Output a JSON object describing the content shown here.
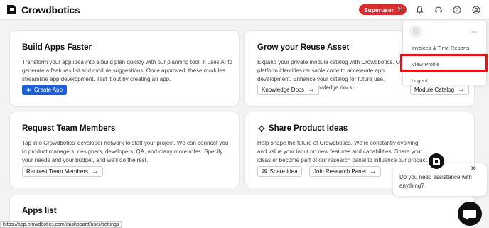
{
  "brand": {
    "name": "Crowdbotics"
  },
  "topbar": {
    "superuser_label": "Superuser",
    "icons": [
      "plus-icon",
      "bell-icon",
      "headset-icon",
      "help-icon",
      "user-icon"
    ]
  },
  "cards": {
    "build": {
      "title": "Build Apps Faster",
      "desc": "Transform your app idea into a build plan quickly with our planning tool. It uses AI to generate a features list and module suggestions. Once approved, these modules streamline app development. Test it out by creating an app.",
      "button": "Create App"
    },
    "reuse": {
      "title": "Grow your Reuse Asset",
      "desc": "Expand your private module catalog with Crowdbotics. Our platform identifies reusable code to accelerate app development. Enhance your catalog for future use. Discover more in our knowledge docs.",
      "btn1": "Knowledge Docs",
      "btn2": "Module Catalog"
    },
    "request": {
      "title": "Request Team Members",
      "desc": "Tap into Crowdbotics' developer network to staff your project. We can connect you to product managers, designers, developers, QA, and many more roles. Specify your needs and your budget, and we'll do the rest.",
      "button": "Request Team Members"
    },
    "share": {
      "title": "Share Product Ideas",
      "desc": "Help shape the future of Crowdbotics. We're constantly evolving and value your input on new features and capabilities. Share your ideas or become part of our research panel to influence our product direction.",
      "btn1": "Share Idea",
      "btn2": "Join Research Panel"
    },
    "apps": {
      "title": "Apps list"
    }
  },
  "dropdown": {
    "items": [
      "Invoices & Time Reports",
      "View Profile",
      "Logout"
    ]
  },
  "chat": {
    "message": "Do you need assistance with anything?",
    "close": "✕"
  },
  "status_url": "https://app.crowdbotics.com/dashboard/user/settings",
  "colors": {
    "primary": "#1d5fd8",
    "badge": "#d92d2d",
    "highlight": "#e3151b"
  }
}
